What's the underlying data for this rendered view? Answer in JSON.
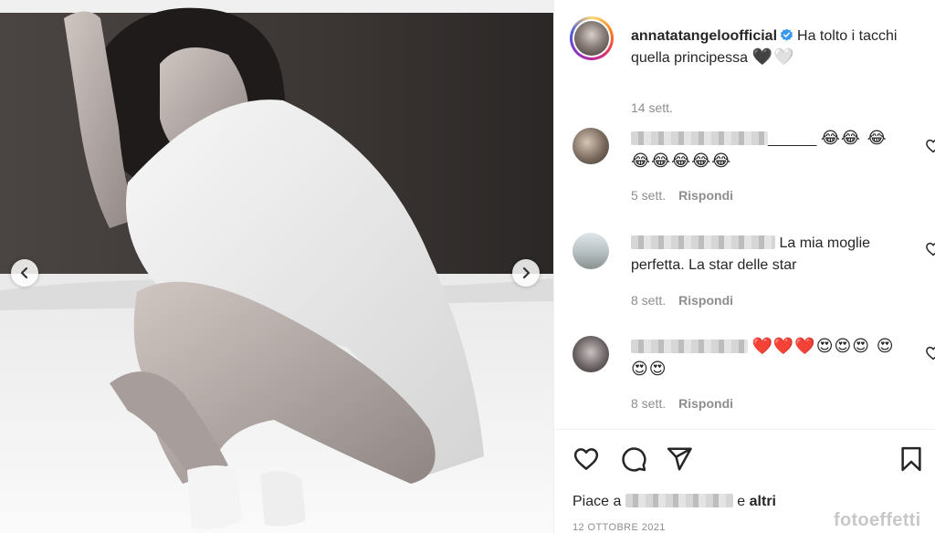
{
  "post": {
    "username": "annatatangeloofficial",
    "caption": "Ha tolto i tacchi quella principessa",
    "caption_emoji": "🖤🤍",
    "caption_time": "14 sett."
  },
  "comments": [
    {
      "text": "______",
      "emoji": "😂😂 😂😂😂😂😂😂",
      "time": "5 sett.",
      "reply_label": "Rispondi"
    },
    {
      "text": "La mia moglie perfetta. La star delle star",
      "time": "8 sett.",
      "reply_label": "Rispondi"
    },
    {
      "text": "",
      "emoji": "❤️❤️❤️😍😍😍 😍😍😍",
      "time": "8 sett.",
      "reply_label": "Rispondi"
    }
  ],
  "likes": {
    "prefix": "Piace a",
    "suffix": "e",
    "others": "altri"
  },
  "date": "12 OTTOBRE 2021",
  "watermark": "fotoeffetti",
  "icons": {
    "prev": "chevron-left-icon",
    "next": "chevron-right-icon",
    "like": "heart-icon",
    "comment": "comment-icon",
    "share": "paper-plane-icon",
    "save": "bookmark-icon",
    "verified": "verified-badge-icon"
  },
  "colors": {
    "verified": "#3897f0",
    "meta_text": "#8e8e8e",
    "text": "#262626"
  }
}
